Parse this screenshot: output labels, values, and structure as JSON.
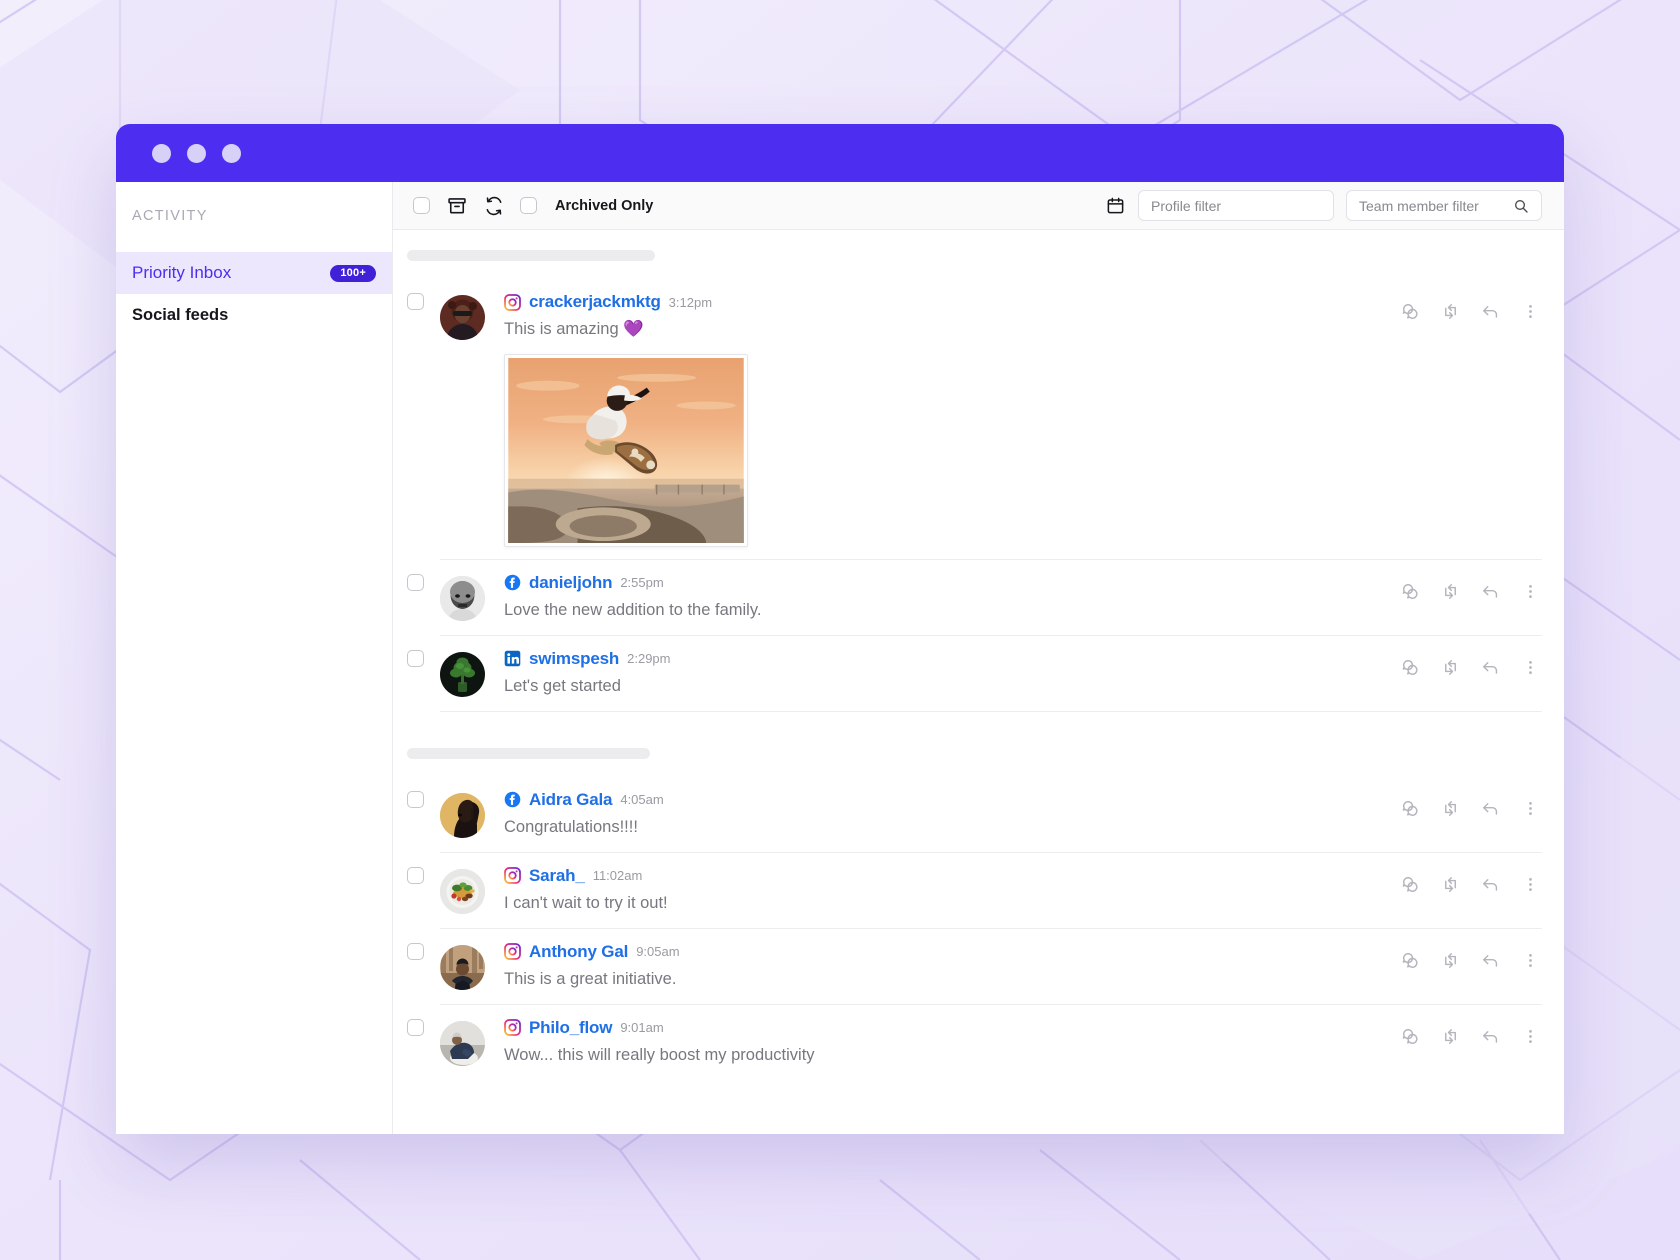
{
  "window": {
    "traffic_lights": [
      "close",
      "minimize",
      "maximize"
    ],
    "accent_color": "#4d2ef0",
    "badge_color": "#4021d8"
  },
  "sidebar": {
    "heading": "ACTIVITY",
    "items": [
      {
        "label": "Priority Inbox",
        "badge": "100+",
        "active": true
      },
      {
        "label": "Social feeds",
        "badge": "",
        "active": false
      }
    ]
  },
  "toolbar": {
    "select_all_checkbox": "",
    "archive_icon": "archive-icon",
    "refresh_icon": "refresh-icon",
    "archived_only_label": "Archived Only",
    "calendar_icon": "calendar-icon",
    "profile_filter_placeholder": "Profile filter",
    "team_filter_placeholder": "Team member filter",
    "search_icon": "search-icon"
  },
  "feed": {
    "groups": [
      {
        "skeleton_width": 248,
        "posts": [
          {
            "network": "instagram",
            "author": "crackerjackmktg",
            "timestamp": "3:12pm",
            "text": "This is amazing 💜",
            "avatar": "woman-sunglasses",
            "media": "skateboarder-sunset"
          },
          {
            "network": "facebook",
            "author": "danieljohn",
            "timestamp": "2:55pm",
            "text": "Love the new addition to the family.",
            "avatar": "man-bw-portrait",
            "media": ""
          },
          {
            "network": "linkedin",
            "author": "swimspesh",
            "timestamp": "2:29pm",
            "text": "Let's get started",
            "avatar": "plant-dark",
            "media": ""
          }
        ]
      },
      {
        "skeleton_width": 243,
        "posts": [
          {
            "network": "facebook",
            "author": "Aidra Gala",
            "timestamp": "4:05am",
            "text": "Congratulations!!!!",
            "avatar": "woman-profile-gold",
            "media": ""
          },
          {
            "network": "instagram",
            "author": "Sarah_",
            "timestamp": "11:02am",
            "text": "I can't wait to try it out!",
            "avatar": "salad-bowl",
            "media": ""
          },
          {
            "network": "instagram",
            "author": "Anthony Gal",
            "timestamp": "9:05am",
            "text": "This is a great initiative.",
            "avatar": "man-forest",
            "media": ""
          },
          {
            "network": "instagram",
            "author": "Philo_flow",
            "timestamp": "9:01am",
            "text": "Wow... this will really boost my productivity",
            "avatar": "man-seated",
            "media": ""
          }
        ]
      }
    ],
    "post_actions": [
      "reply-bubbles-icon",
      "repost-icon",
      "reply-arrow-icon",
      "more-menu-icon"
    ]
  }
}
